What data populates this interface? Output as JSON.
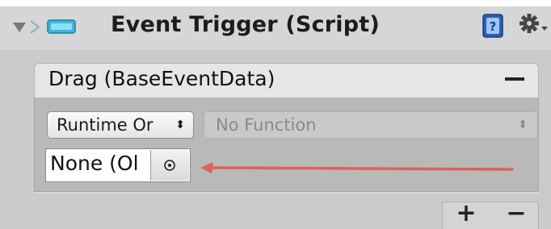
{
  "component": {
    "title": "Event Trigger (Script)",
    "icons": [
      "fold-arrow-icon",
      "script-icon",
      "component-icon",
      "help-icon",
      "gear-icon"
    ]
  },
  "entry": {
    "title": "Drag (BaseEventData)",
    "remove_label": "−",
    "runtime_select": {
      "value": "Runtime Or",
      "arrow": "⬍"
    },
    "function_select": {
      "value": "No Function",
      "arrow": "⬍"
    },
    "object_field": {
      "value": "None (Ol",
      "picker_icon": "⊙"
    }
  },
  "footer": {
    "add_label": "+",
    "remove_label": "−"
  },
  "colors": {
    "panel_bg": "#cbcbcb",
    "entry_header_bg": "#e6e6e6",
    "annotation_arrow": "#e0605a",
    "help_icon_blue": "#2f5fb0"
  }
}
